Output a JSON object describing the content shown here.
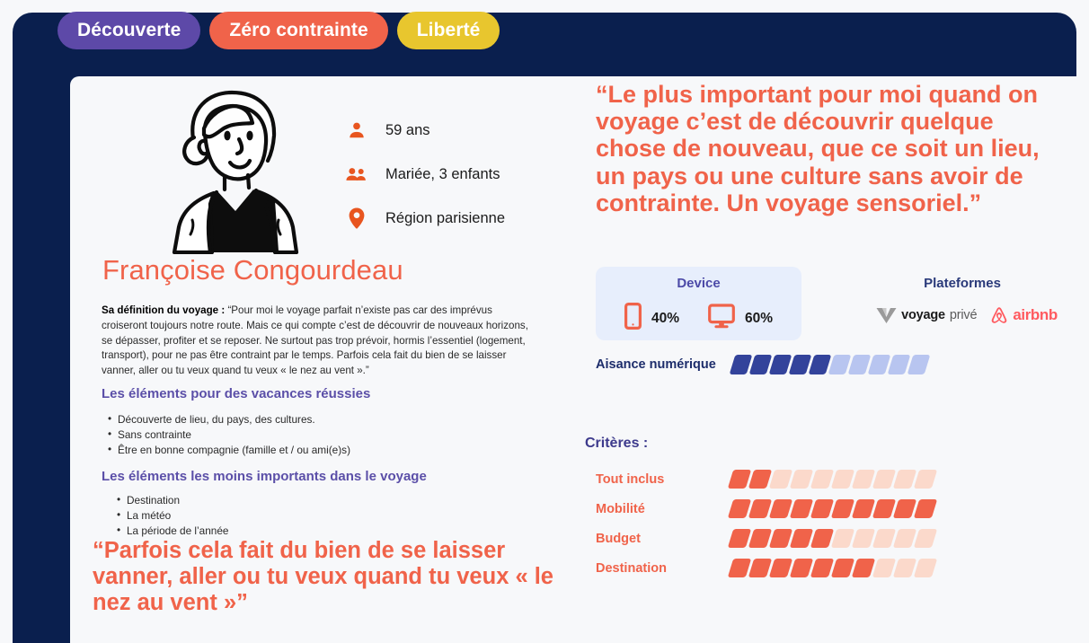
{
  "tabs": [
    {
      "label": "Découverte",
      "color": "#5d49a8"
    },
    {
      "label": "Zéro contrainte",
      "color": "#f0634a"
    },
    {
      "label": "Liberté",
      "color": "#e8c62e"
    }
  ],
  "profile": {
    "name": "Françoise Congourdeau",
    "facts": [
      {
        "icon": "person-icon",
        "text": "59 ans"
      },
      {
        "icon": "people-icon",
        "text": "Mariée, 3 enfants"
      },
      {
        "icon": "location-pin-icon",
        "text": "Région parisienne"
      }
    ],
    "definition_label": "Sa définition du voyage :",
    "definition_text": " “Pour moi le voyage parfait n’existe pas car des imprévus croiseront toujours notre route. Mais ce qui compte c’est de découvrir de nouveaux horizons, se dépasser, profiter et se reposer. Ne surtout pas trop prévoir, hormis l’essentiel (logement, transport), pour ne pas être contraint par le temps. Parfois cela fait du bien de se laisser vanner, aller ou tu veux quand tu veux « le nez au vent ».”"
  },
  "sections": {
    "success_title": "Les éléments pour des vacances réussies",
    "success_items": [
      "Découverte de lieu, du pays, des cultures.",
      "Sans contrainte",
      "Être en bonne compagnie (famille et / ou ami(e)s)"
    ],
    "least_title": "Les éléments les moins importants dans le voyage",
    "least_items": [
      "Destination",
      "La météo",
      "La période de l’année"
    ]
  },
  "quotes": {
    "main": "“Le plus important pour moi quand on voyage c’est de découvrir quelque chose de nouveau, que ce soit un lieu, un pays ou une culture sans avoir de contrainte. Un voyage sensoriel.”",
    "bottom": "“Parfois cela fait du bien de se laisser vanner, aller ou tu veux quand tu veux « le nez au vent »”"
  },
  "device": {
    "title": "Device",
    "items": [
      {
        "icon": "mobile-phone-icon",
        "percent": "40%"
      },
      {
        "icon": "desktop-monitor-icon",
        "percent": "60%"
      }
    ]
  },
  "platforms": {
    "title": "Plateformes",
    "logos": [
      {
        "name": "voyage-prive-logo",
        "text_bold": "voyage",
        "text_light": "privé"
      },
      {
        "name": "airbnb-logo",
        "text": "airbnb"
      }
    ]
  },
  "digital_skill": {
    "label": "Aisance numérique",
    "filled": 5,
    "total": 10,
    "filled_color": "#33439b",
    "empty_color": "#b8c5f0"
  },
  "criteres": {
    "title": "Critères :",
    "filled_color": "#f0634a",
    "empty_color": "#fbd9cb",
    "total": 10,
    "rows": [
      {
        "label": "Tout inclus",
        "filled": 2
      },
      {
        "label": "Mobilité",
        "filled": 10
      },
      {
        "label": "Budget",
        "filled": 5
      },
      {
        "label": "Destination",
        "filled": 7
      }
    ]
  }
}
